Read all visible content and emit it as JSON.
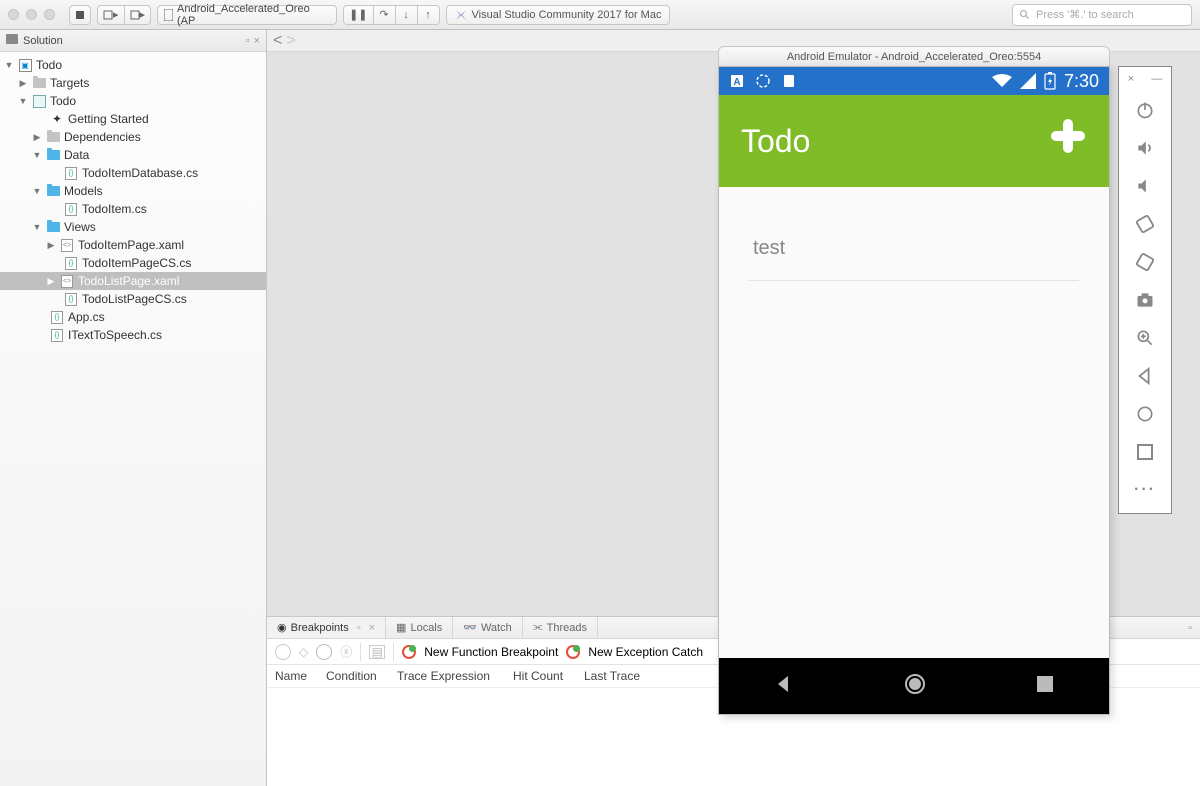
{
  "toolbar": {
    "target": "Android_Accelerated_Oreo (AP",
    "app_title": "Visual Studio Community 2017 for Mac",
    "search_placeholder": "Press '⌘.' to search"
  },
  "sidebar": {
    "title": "Solution",
    "solution_name": "Todo",
    "targets": "Targets",
    "project": "Todo",
    "getting_started": "Getting Started",
    "dependencies": "Dependencies",
    "data_folder": "Data",
    "data_file": "TodoItemDatabase.cs",
    "models_folder": "Models",
    "models_file": "TodoItem.cs",
    "views_folder": "Views",
    "views_files": {
      "f1": "TodoItemPage.xaml",
      "f2": "TodoItemPageCS.cs",
      "f3": "TodoListPage.xaml",
      "f4": "TodoListPageCS.cs"
    },
    "app_cs": "App.cs",
    "itext": "ITextToSpeech.cs"
  },
  "bottom": {
    "tab_breakpoints": "Breakpoints",
    "tab_locals": "Locals",
    "tab_watch": "Watch",
    "tab_threads": "Threads",
    "new_func": "New Function Breakpoint",
    "new_exc": "New Exception Catch",
    "col_name": "Name",
    "col_cond": "Condition",
    "col_trace": "Trace Expression",
    "col_hit": "Hit Count",
    "col_last": "Last Trace"
  },
  "emulator": {
    "title": "Android Emulator - Android_Accelerated_Oreo:5554",
    "time": "7:30",
    "app_title": "Todo",
    "item1": "test"
  }
}
